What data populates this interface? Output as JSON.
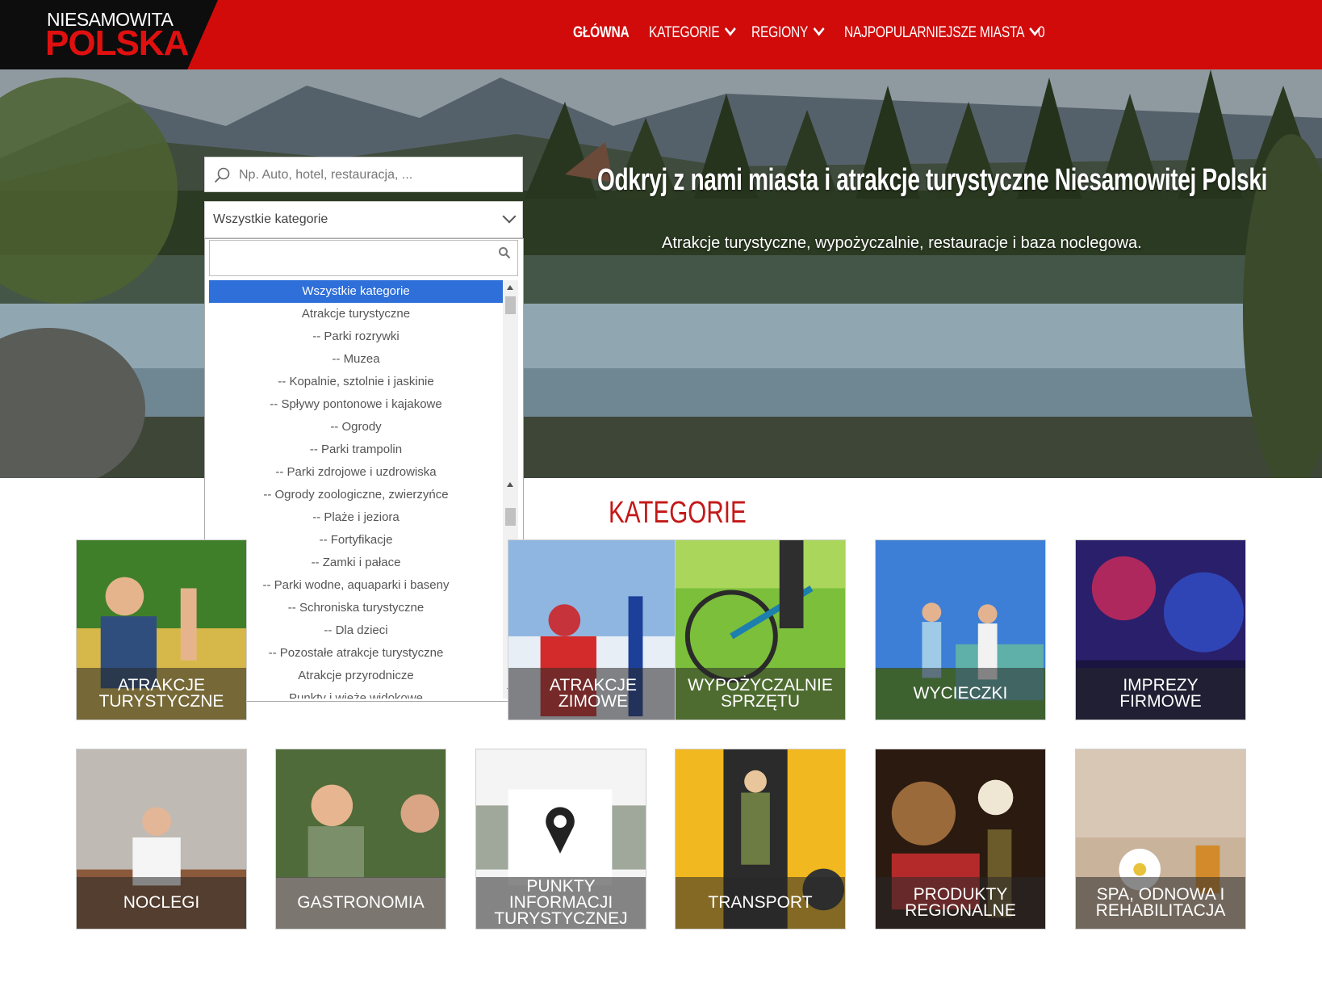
{
  "header": {
    "logo_top": "NIESAMOWITA",
    "logo_bottom": "POLSKA",
    "nav": [
      {
        "label": "GŁÓWNA"
      },
      {
        "label": "KATEGORIE"
      },
      {
        "label": "REGIONY"
      },
      {
        "label": "NAJPOPULARNIEJSZE MIASTA"
      },
      {
        "label": "0"
      }
    ]
  },
  "hero": {
    "title": "Odkryj z nami miasta i atrakcje turystyczne Niesamowitej Polski",
    "subtitle": "Atrakcje turystyczne, wypożyczalnie, restauracje i baza noclegowa."
  },
  "search": {
    "placeholder": "Np. Auto, hotel, restauracja, ...",
    "category_selected": "Wszystkie kategorie",
    "dropdown_items": [
      "Wszystkie kategorie",
      "Atrakcje turystyczne",
      "-- Parki rozrywki",
      "-- Muzea",
      "-- Kopalnie, sztolnie i jaskinie",
      "-- Spływy pontonowe i kajakowe",
      "-- Ogrody",
      "-- Parki trampolin",
      "-- Parki zdrojowe i uzdrowiska",
      "-- Ogrody zoologiczne, zwierzyńce",
      "-- Plaże i jeziora",
      "-- Fortyfikacje",
      "-- Zamki i pałace",
      "-- Parki wodne, aquaparki i baseny",
      "-- Schroniska turystyczne",
      "-- Dla dzieci",
      "-- Pozostałe atrakcje turystyczne",
      "Atrakcje przyrodnicze",
      "Punkty i wieże widokowe"
    ]
  },
  "categories": {
    "title": "KATEGORIE",
    "tiles": [
      {
        "label": "ATRAKCJE\nTURYSTYCZNE"
      },
      {
        "label": "ATRAKCJE\nZIMOWE"
      },
      {
        "label": "WYPOŻYCZALNIE\nSPRZĘTU"
      },
      {
        "label": "WYCIECZKI"
      },
      {
        "label": "IMPREZY\nFIRMOWE"
      },
      {
        "label": "NOCLEGI"
      },
      {
        "label": "GASTRONOMIA"
      },
      {
        "label": "PUNKTY\nINFORMACJI\nTURYSTYCZNEJ"
      },
      {
        "label": "TRANSPORT"
      },
      {
        "label": "PRODUKTY\nREGIONALNE"
      },
      {
        "label": "SPA, ODNOWA I\nREHABILITACJA"
      }
    ]
  },
  "colors": {
    "brand_red": "#d10a0a",
    "logo_black": "#0d0d0d",
    "selected_blue": "#2f6fd9"
  }
}
